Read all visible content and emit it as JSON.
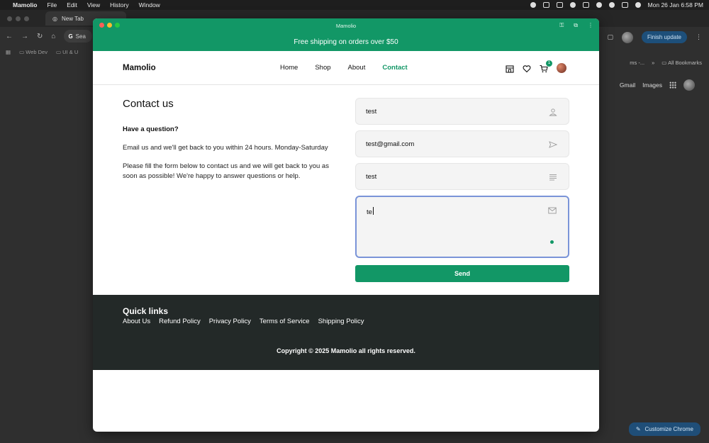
{
  "menubar": {
    "app_name": "Mamolio",
    "items": [
      "File",
      "Edit",
      "View",
      "History",
      "Window"
    ],
    "datetime": "Mon 26 Jan  6:58 PM"
  },
  "bg_chrome": {
    "tab_title": "New Tab",
    "omnibox_text": "Sea",
    "finish_update": "Finish update",
    "bookmarks": [
      "Web Dev",
      "UI & U"
    ],
    "bookmark_partial_right": "ms -...",
    "all_bookmarks": "All Bookmarks",
    "google_links": [
      "Gmail",
      "Images"
    ],
    "customize_label": "Customize Chrome"
  },
  "window": {
    "title": "Mamolio"
  },
  "announcement": "Free shipping on orders over $50",
  "header": {
    "logo": "Mamolio",
    "nav": [
      {
        "label": "Home",
        "active": false
      },
      {
        "label": "Shop",
        "active": false
      },
      {
        "label": "About",
        "active": false
      },
      {
        "label": "Contact",
        "active": true
      }
    ],
    "cart_count": "1"
  },
  "contact": {
    "title": "Contact us",
    "question": "Have a question?",
    "para1": "Email us and we'll get back to you within 24 hours. Monday-Saturday",
    "para2": "Please fill the form below to contact us and we will get back to you as soon as possible! We're happy to answer questions or help."
  },
  "form": {
    "name_value": "test",
    "email_value": "test@gmail.com",
    "subject_value": "test",
    "message_value": "te",
    "send_label": "Send"
  },
  "footer": {
    "heading": "Quick links",
    "links": [
      "About Us",
      "Refund Policy",
      "Privacy Policy",
      "Terms of Service",
      "Shipping Policy"
    ],
    "copyright": "Copyright © 2025 Mamolio all rights reserved."
  },
  "colors": {
    "brand_green": "#129766",
    "footer_bg": "#232928",
    "focus_border": "#7a94d8"
  }
}
